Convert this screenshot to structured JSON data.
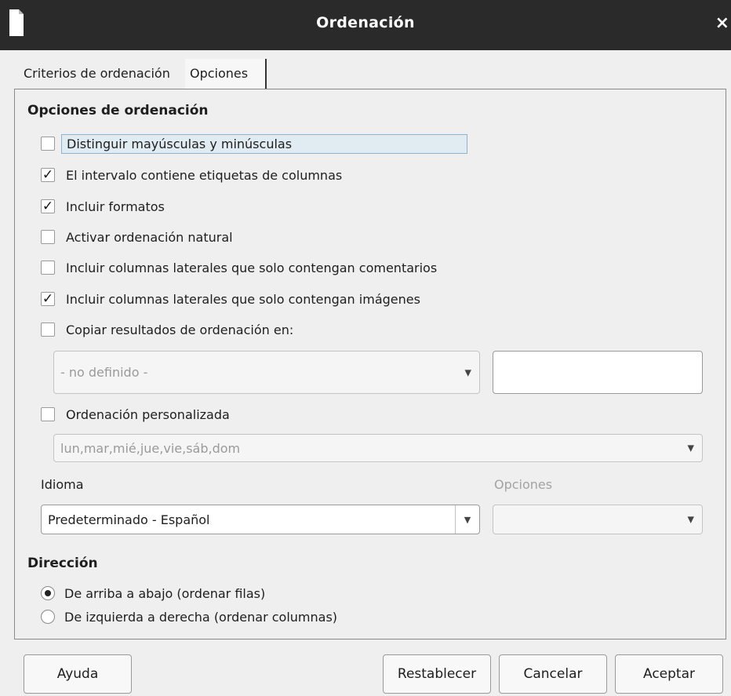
{
  "window": {
    "title": "Ordenación"
  },
  "tabs": [
    {
      "label": "Criterios de ordenación",
      "active": false
    },
    {
      "label": "Opciones",
      "active": true
    }
  ],
  "sort_options": {
    "heading": "Opciones de ordenación",
    "checkboxes": [
      {
        "label": "Distinguir mayúsculas y minúsculas",
        "checked": false
      },
      {
        "label": "El intervalo contiene etiquetas de columnas",
        "checked": true
      },
      {
        "label": "Incluir formatos",
        "checked": true
      },
      {
        "label": "Activar ordenación natural",
        "checked": false
      },
      {
        "label": "Incluir columnas laterales que solo contengan comentarios",
        "checked": false
      },
      {
        "label": "Incluir columnas laterales que solo contengan imágenes",
        "checked": true
      },
      {
        "label": "Copiar resultados de ordenación en:",
        "checked": false
      }
    ],
    "copy_target": {
      "value": "- no definido -",
      "text": ""
    },
    "custom_sort": {
      "label": "Ordenación personalizada",
      "checked": false,
      "value": "lun,mar,mié,jue,vie,sáb,dom"
    },
    "language": {
      "label": "Idioma",
      "value": "Predeterminado - Español"
    },
    "options": {
      "label": "Opciones",
      "value": ""
    }
  },
  "direction": {
    "heading": "Dirección",
    "radios": [
      {
        "label": "De arriba a abajo (ordenar filas)",
        "selected": true
      },
      {
        "label": "De izquierda a derecha (ordenar columnas)",
        "selected": false
      }
    ]
  },
  "buttons": {
    "help": "Ayuda",
    "reset": "Restablecer",
    "cancel": "Cancelar",
    "ok": "Aceptar"
  },
  "icons": {
    "close": "close-icon",
    "dropdown": "chevron-down-icon",
    "app": "document-icon"
  }
}
